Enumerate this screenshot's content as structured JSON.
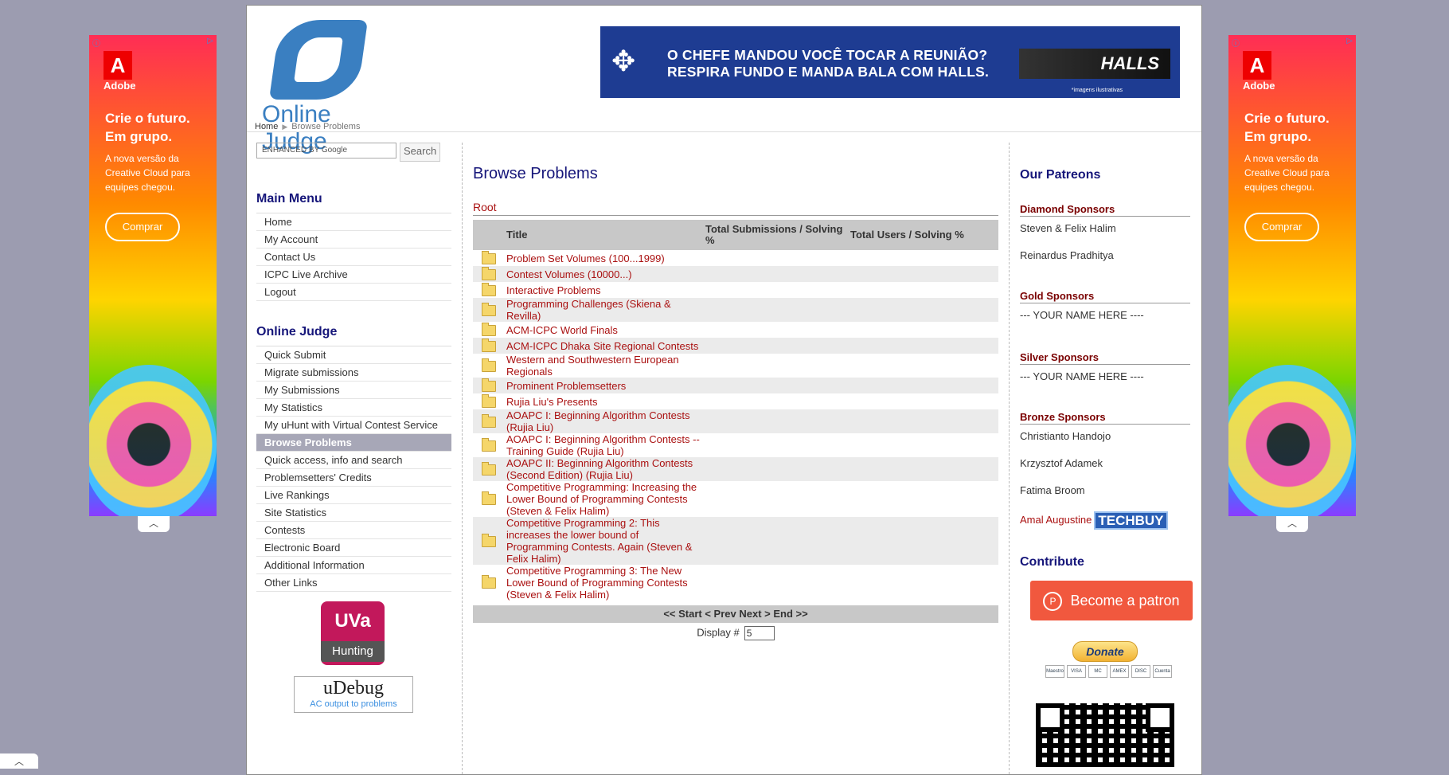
{
  "side_ad": {
    "brand": "Adobe",
    "headline": "Crie o futuro. Em grupo.",
    "body": "A nova versão da Creative Cloud para equipes chegou.",
    "cta": "Comprar",
    "collapse_icon": "chevron-up-icon"
  },
  "corner_tab": {
    "icon": "chevron-up-icon"
  },
  "header": {
    "logo_text": "Online Judge",
    "breadcrumb": {
      "home": "Home",
      "current": "Browse Problems"
    },
    "banner": {
      "line1": "O CHEFE MANDOU VOCÊ TOCAR A REUNIÃO?",
      "line2": "RESPIRA FUNDO E MANDA BALA COM HALLS.",
      "product": "HALLS",
      "note": "*imagens ilustrativas"
    }
  },
  "search": {
    "placeholder": "ENHANCED BY Google",
    "button": "Search"
  },
  "main_menu": {
    "title": "Main Menu",
    "items": [
      "Home",
      "My Account",
      "Contact Us",
      "ICPC Live Archive",
      "Logout"
    ]
  },
  "oj_menu": {
    "title": "Online Judge",
    "items": [
      "Quick Submit",
      "Migrate submissions",
      "My Submissions",
      "My Statistics",
      "My uHunt with Virtual Contest Service",
      "Browse Problems",
      "Quick access, info and search",
      "Problemsetters' Credits",
      "Live Rankings",
      "Site Statistics",
      "Contests",
      "Electronic Board",
      "Additional Information",
      "Other Links"
    ],
    "active_index": 5
  },
  "uva_badge": {
    "top": "UVa",
    "bottom": "Hunting"
  },
  "udebug": {
    "name": "uDebug",
    "tagline": "AC output to problems"
  },
  "main": {
    "title": "Browse Problems",
    "root": "Root",
    "columns": {
      "icon": "",
      "title": "Title",
      "submissions": "Total Submissions / Solving %",
      "users": "Total Users / Solving %"
    },
    "rows": [
      "Problem Set Volumes (100...1999)",
      "Contest Volumes (10000...)",
      "Interactive Problems",
      "Programming Challenges (Skiena & Revilla)",
      "ACM-ICPC World Finals",
      "ACM-ICPC Dhaka Site Regional Contests",
      "Western and Southwestern European Regionals",
      "Prominent Problemsetters",
      "Rujia Liu's Presents",
      "AOAPC I: Beginning Algorithm Contests (Rujia Liu)",
      "AOAPC I: Beginning Algorithm Contests -- Training Guide (Rujia Liu)",
      "AOAPC II: Beginning Algorithm Contests (Second Edition) (Rujia Liu)",
      "Competitive Programming: Increasing the Lower Bound of Programming Contests (Steven & Felix Halim)",
      "Competitive Programming 2: This increases the lower bound of Programming Contests. Again (Steven & Felix Halim)",
      "Competitive Programming 3: The New Lower Bound of Programming Contests (Steven & Felix Halim)"
    ],
    "row_icon": "folder-icon",
    "pager": "<< Start < Prev Next > End >>",
    "display_label": "Display #",
    "display_value": "5"
  },
  "patreons": {
    "title": "Our Patreons",
    "diamond": {
      "label": "Diamond Sponsors",
      "names": [
        "Steven & Felix Halim",
        "Reinardus Pradhitya"
      ]
    },
    "gold": {
      "label": "Gold Sponsors",
      "names": [
        "--- YOUR NAME HERE ----"
      ]
    },
    "silver": {
      "label": "Silver Sponsors",
      "names": [
        "--- YOUR NAME HERE ----"
      ]
    },
    "bronze": {
      "label": "Bronze Sponsors",
      "names": [
        "Christianto Handojo",
        "Krzysztof Adamek",
        "Fatima Broom",
        "Amal Augustine"
      ]
    },
    "techbuy": "TECHBUY"
  },
  "contribute": {
    "title": "Contribute",
    "patreon_button": "Become a patron",
    "donate_button": "Donate",
    "cards": [
      "Maestro",
      "VISA",
      "MC",
      "AMEX",
      "DISC",
      "Cuenta"
    ]
  },
  "colors": {
    "heading": "#16167a",
    "link": "#aa1111",
    "active_menu": "#a7a7b7",
    "background": "#9c9cb0"
  }
}
